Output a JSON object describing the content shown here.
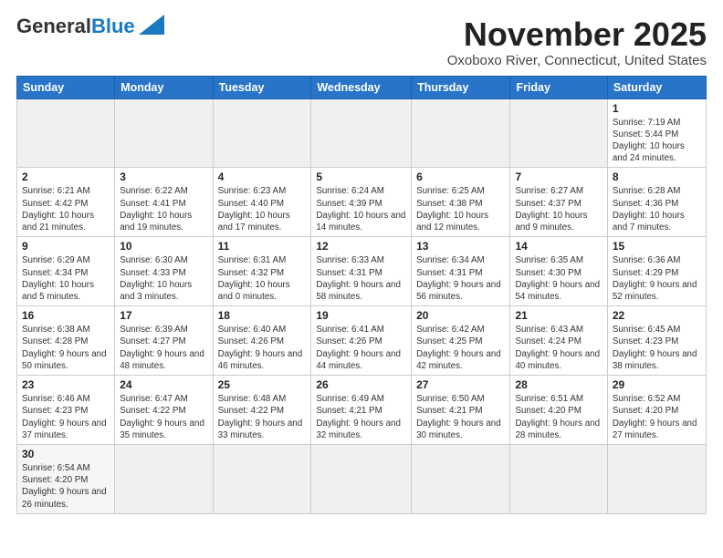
{
  "header": {
    "logo": {
      "line1": "General",
      "line2": "Blue"
    },
    "title": "November 2025",
    "location": "Oxoboxo River, Connecticut, United States"
  },
  "weekdays": [
    "Sunday",
    "Monday",
    "Tuesday",
    "Wednesday",
    "Thursday",
    "Friday",
    "Saturday"
  ],
  "weeks": [
    [
      {
        "day": "",
        "info": ""
      },
      {
        "day": "",
        "info": ""
      },
      {
        "day": "",
        "info": ""
      },
      {
        "day": "",
        "info": ""
      },
      {
        "day": "",
        "info": ""
      },
      {
        "day": "",
        "info": ""
      },
      {
        "day": "1",
        "info": "Sunrise: 7:19 AM\nSunset: 5:44 PM\nDaylight: 10 hours and 24 minutes."
      }
    ],
    [
      {
        "day": "2",
        "info": "Sunrise: 6:21 AM\nSunset: 4:42 PM\nDaylight: 10 hours and 21 minutes."
      },
      {
        "day": "3",
        "info": "Sunrise: 6:22 AM\nSunset: 4:41 PM\nDaylight: 10 hours and 19 minutes."
      },
      {
        "day": "4",
        "info": "Sunrise: 6:23 AM\nSunset: 4:40 PM\nDaylight: 10 hours and 17 minutes."
      },
      {
        "day": "5",
        "info": "Sunrise: 6:24 AM\nSunset: 4:39 PM\nDaylight: 10 hours and 14 minutes."
      },
      {
        "day": "6",
        "info": "Sunrise: 6:25 AM\nSunset: 4:38 PM\nDaylight: 10 hours and 12 minutes."
      },
      {
        "day": "7",
        "info": "Sunrise: 6:27 AM\nSunset: 4:37 PM\nDaylight: 10 hours and 9 minutes."
      },
      {
        "day": "8",
        "info": "Sunrise: 6:28 AM\nSunset: 4:36 PM\nDaylight: 10 hours and 7 minutes."
      }
    ],
    [
      {
        "day": "9",
        "info": "Sunrise: 6:29 AM\nSunset: 4:34 PM\nDaylight: 10 hours and 5 minutes."
      },
      {
        "day": "10",
        "info": "Sunrise: 6:30 AM\nSunset: 4:33 PM\nDaylight: 10 hours and 3 minutes."
      },
      {
        "day": "11",
        "info": "Sunrise: 6:31 AM\nSunset: 4:32 PM\nDaylight: 10 hours and 0 minutes."
      },
      {
        "day": "12",
        "info": "Sunrise: 6:33 AM\nSunset: 4:31 PM\nDaylight: 9 hours and 58 minutes."
      },
      {
        "day": "13",
        "info": "Sunrise: 6:34 AM\nSunset: 4:31 PM\nDaylight: 9 hours and 56 minutes."
      },
      {
        "day": "14",
        "info": "Sunrise: 6:35 AM\nSunset: 4:30 PM\nDaylight: 9 hours and 54 minutes."
      },
      {
        "day": "15",
        "info": "Sunrise: 6:36 AM\nSunset: 4:29 PM\nDaylight: 9 hours and 52 minutes."
      }
    ],
    [
      {
        "day": "16",
        "info": "Sunrise: 6:38 AM\nSunset: 4:28 PM\nDaylight: 9 hours and 50 minutes."
      },
      {
        "day": "17",
        "info": "Sunrise: 6:39 AM\nSunset: 4:27 PM\nDaylight: 9 hours and 48 minutes."
      },
      {
        "day": "18",
        "info": "Sunrise: 6:40 AM\nSunset: 4:26 PM\nDaylight: 9 hours and 46 minutes."
      },
      {
        "day": "19",
        "info": "Sunrise: 6:41 AM\nSunset: 4:26 PM\nDaylight: 9 hours and 44 minutes."
      },
      {
        "day": "20",
        "info": "Sunrise: 6:42 AM\nSunset: 4:25 PM\nDaylight: 9 hours and 42 minutes."
      },
      {
        "day": "21",
        "info": "Sunrise: 6:43 AM\nSunset: 4:24 PM\nDaylight: 9 hours and 40 minutes."
      },
      {
        "day": "22",
        "info": "Sunrise: 6:45 AM\nSunset: 4:23 PM\nDaylight: 9 hours and 38 minutes."
      }
    ],
    [
      {
        "day": "23",
        "info": "Sunrise: 6:46 AM\nSunset: 4:23 PM\nDaylight: 9 hours and 37 minutes."
      },
      {
        "day": "24",
        "info": "Sunrise: 6:47 AM\nSunset: 4:22 PM\nDaylight: 9 hours and 35 minutes."
      },
      {
        "day": "25",
        "info": "Sunrise: 6:48 AM\nSunset: 4:22 PM\nDaylight: 9 hours and 33 minutes."
      },
      {
        "day": "26",
        "info": "Sunrise: 6:49 AM\nSunset: 4:21 PM\nDaylight: 9 hours and 32 minutes."
      },
      {
        "day": "27",
        "info": "Sunrise: 6:50 AM\nSunset: 4:21 PM\nDaylight: 9 hours and 30 minutes."
      },
      {
        "day": "28",
        "info": "Sunrise: 6:51 AM\nSunset: 4:20 PM\nDaylight: 9 hours and 28 minutes."
      },
      {
        "day": "29",
        "info": "Sunrise: 6:52 AM\nSunset: 4:20 PM\nDaylight: 9 hours and 27 minutes."
      }
    ],
    [
      {
        "day": "30",
        "info": "Sunrise: 6:54 AM\nSunset: 4:20 PM\nDaylight: 9 hours and 26 minutes."
      },
      {
        "day": "",
        "info": ""
      },
      {
        "day": "",
        "info": ""
      },
      {
        "day": "",
        "info": ""
      },
      {
        "day": "",
        "info": ""
      },
      {
        "day": "",
        "info": ""
      },
      {
        "day": "",
        "info": ""
      }
    ]
  ]
}
